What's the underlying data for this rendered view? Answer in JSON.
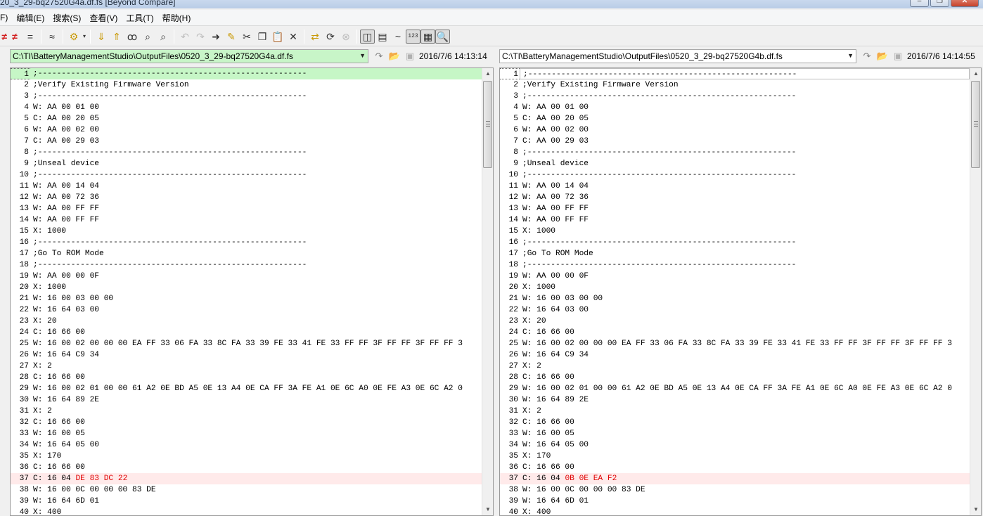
{
  "window": {
    "title": "20_3_29-bq27520G4a.df.fs  [Beyond Compare]",
    "buttons": [
      "–",
      "❐",
      "✕"
    ]
  },
  "menu": [
    "F)",
    "编辑(E)",
    "搜索(S)",
    "查看(V)",
    "工具(T)",
    "帮助(H)"
  ],
  "toolbar": {
    "icons": [
      "not-equal-icon",
      "not-equal-icon",
      "equals-icon",
      "approx-icon",
      "rules-icon",
      "next-diff-icon",
      "prev-diff-icon",
      "binoculars-icon",
      "find-next-icon",
      "find-prev-icon",
      "undo-icon",
      "redo-icon",
      "copy-to-other-side-icon",
      "edit-icon",
      "cut-icon",
      "copy-icon",
      "paste-icon",
      "delete-icon",
      "swap-icon",
      "refresh-icon",
      "stop-icon",
      "side-by-side-icon",
      "over-under-icon",
      "ignore-unimportant-icon",
      "line-numbers-icon",
      "context-icon",
      "zoom-icon"
    ],
    "tilde": "~",
    "numbers_label": "123"
  },
  "left": {
    "path": "C:\\TI\\BatteryManagementStudio\\OutputFiles\\0520_3_29-bq27520G4a.df.fs",
    "timestamp": "2016/7/6 14:13:14"
  },
  "right": {
    "path": "C:\\TI\\BatteryManagementStudio\\OutputFiles\\0520_3_29-bq27520G4b.df.fs",
    "timestamp": "2016/7/6 14:14:55"
  },
  "colors": {
    "left_path_bg": "#c8f5c8",
    "diff_bg": "#ffeaea",
    "diff_text": "#e00000",
    "current_line_bg": "#c6f6c6"
  },
  "lines": [
    {
      "n": "1",
      "l": ";---------------------------------------------------------",
      "r": ";---------------------------------------------------------"
    },
    {
      "n": "2",
      "l": ";Verify Existing Firmware Version",
      "r": ";Verify Existing Firmware Version"
    },
    {
      "n": "3",
      "l": ";---------------------------------------------------------",
      "r": ";---------------------------------------------------------"
    },
    {
      "n": "4",
      "l": "W: AA 00 01 00",
      "r": "W: AA 00 01 00"
    },
    {
      "n": "5",
      "l": "C: AA 00 20 05",
      "r": "C: AA 00 20 05"
    },
    {
      "n": "6",
      "l": "W: AA 00 02 00",
      "r": "W: AA 00 02 00"
    },
    {
      "n": "7",
      "l": "C: AA 00 29 03",
      "r": "C: AA 00 29 03"
    },
    {
      "n": "8",
      "l": ";---------------------------------------------------------",
      "r": ";---------------------------------------------------------"
    },
    {
      "n": "9",
      "l": ";Unseal device",
      "r": ";Unseal device"
    },
    {
      "n": "10",
      "l": ";---------------------------------------------------------",
      "r": ";---------------------------------------------------------"
    },
    {
      "n": "11",
      "l": "W: AA 00 14 04",
      "r": "W: AA 00 14 04"
    },
    {
      "n": "12",
      "l": "W: AA 00 72 36",
      "r": "W: AA 00 72 36"
    },
    {
      "n": "13",
      "l": "W: AA 00 FF FF",
      "r": "W: AA 00 FF FF"
    },
    {
      "n": "14",
      "l": "W: AA 00 FF FF",
      "r": "W: AA 00 FF FF"
    },
    {
      "n": "15",
      "l": "X: 1000",
      "r": "X: 1000"
    },
    {
      "n": "16",
      "l": ";---------------------------------------------------------",
      "r": ";---------------------------------------------------------"
    },
    {
      "n": "17",
      "l": ";Go To ROM Mode",
      "r": ";Go To ROM Mode"
    },
    {
      "n": "18",
      "l": ";---------------------------------------------------------",
      "r": ";---------------------------------------------------------"
    },
    {
      "n": "19",
      "l": "W: AA 00 00 0F",
      "r": "W: AA 00 00 0F"
    },
    {
      "n": "20",
      "l": "X: 1000",
      "r": "X: 1000"
    },
    {
      "n": "21",
      "l": "W: 16 00 03 00 00",
      "r": "W: 16 00 03 00 00"
    },
    {
      "n": "22",
      "l": "W: 16 64 03 00",
      "r": "W: 16 64 03 00"
    },
    {
      "n": "23",
      "l": "X: 20",
      "r": "X: 20"
    },
    {
      "n": "24",
      "l": "C: 16 66 00",
      "r": "C: 16 66 00"
    },
    {
      "n": "25",
      "l": "W: 16 00 02 00 00 00 EA FF 33 06 FA 33 8C FA 33 39 FE 33 41 FE 33 FF FF 3F FF FF 3F FF FF 3",
      "r": "W: 16 00 02 00 00 00 EA FF 33 06 FA 33 8C FA 33 39 FE 33 41 FE 33 FF FF 3F FF FF 3F FF FF 3"
    },
    {
      "n": "26",
      "l": "W: 16 64 C9 34",
      "r": "W: 16 64 C9 34"
    },
    {
      "n": "27",
      "l": "X: 2",
      "r": "X: 2"
    },
    {
      "n": "28",
      "l": "C: 16 66 00",
      "r": "C: 16 66 00"
    },
    {
      "n": "29",
      "l": "W: 16 00 02 01 00 00 61 A2 0E BD A5 0E 13 A4 0E CA FF 3A FE A1 0E 6C A0 0E FE A3 0E 6C A2 0",
      "r": "W: 16 00 02 01 00 00 61 A2 0E BD A5 0E 13 A4 0E CA FF 3A FE A1 0E 6C A0 0E FE A3 0E 6C A2 0"
    },
    {
      "n": "30",
      "l": "W: 16 64 89 2E",
      "r": "W: 16 64 89 2E"
    },
    {
      "n": "31",
      "l": "X: 2",
      "r": "X: 2"
    },
    {
      "n": "32",
      "l": "C: 16 66 00",
      "r": "C: 16 66 00"
    },
    {
      "n": "33",
      "l": "W: 16 00 05",
      "r": "W: 16 00 05"
    },
    {
      "n": "34",
      "l": "W: 16 64 05 00",
      "r": "W: 16 64 05 00"
    },
    {
      "n": "35",
      "l": "X: 170",
      "r": "X: 170"
    },
    {
      "n": "36",
      "l": "C: 16 66 00",
      "r": "C: 16 66 00"
    },
    {
      "n": "37",
      "l": "C: 16 04 ",
      "l_hl": "DE 83 DC 22",
      "r": "C: 16 04 ",
      "r_hl": "0B 0E EA F2",
      "diff": true
    },
    {
      "n": "38",
      "l": "W: 16 00 0C 00 00 00 83 DE",
      "r": "W: 16 00 0C 00 00 00 83 DE"
    },
    {
      "n": "39",
      "l": "W: 16 64 6D 01",
      "r": "W: 16 64 6D 01"
    },
    {
      "n": "40",
      "l": "X: 400",
      "r": "X: 400"
    }
  ]
}
